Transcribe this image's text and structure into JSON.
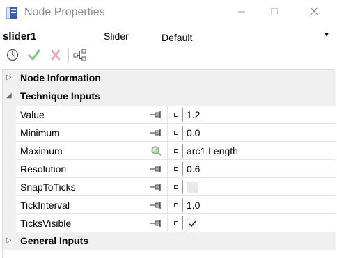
{
  "window": {
    "title": "Node Properties",
    "icon": "node-properties-app-icon",
    "controls": [
      "minimize-icon",
      "maximize-icon",
      "close-icon"
    ]
  },
  "node": {
    "name": "slider1",
    "type": "Slider",
    "style_selected": "Default"
  },
  "toolbar": {
    "icons": [
      "history-clock-icon",
      "accept-check-icon",
      "reject-x-icon",
      "node-graph-icon"
    ]
  },
  "sections": {
    "node_information": "Node Information",
    "technique_inputs": "Technique Inputs",
    "general_inputs": "General Inputs"
  },
  "properties": [
    {
      "name": "Value",
      "value": "1.2",
      "kind": "text",
      "source_icon": "pin-icon"
    },
    {
      "name": "Minimum",
      "value": "0.0",
      "kind": "text",
      "source_icon": "pin-icon"
    },
    {
      "name": "Maximum",
      "value": "arc1.Length",
      "kind": "text",
      "source_icon": "link-globe-icon"
    },
    {
      "name": "Resolution",
      "value": "0.6",
      "kind": "text",
      "source_icon": "pin-icon"
    },
    {
      "name": "SnapToTicks",
      "value": "",
      "kind": "checkbox",
      "checked": false,
      "source_icon": "pin-icon"
    },
    {
      "name": "TickInterval",
      "value": "1.0",
      "kind": "text",
      "source_icon": "pin-icon"
    },
    {
      "name": "TicksVisible",
      "value": "",
      "kind": "checkbox",
      "checked": true,
      "source_icon": "pin-icon"
    }
  ],
  "colors": {
    "section_bg": "#f0f0f0",
    "check_green": "#3aa63a",
    "x_red": "#e05050"
  }
}
